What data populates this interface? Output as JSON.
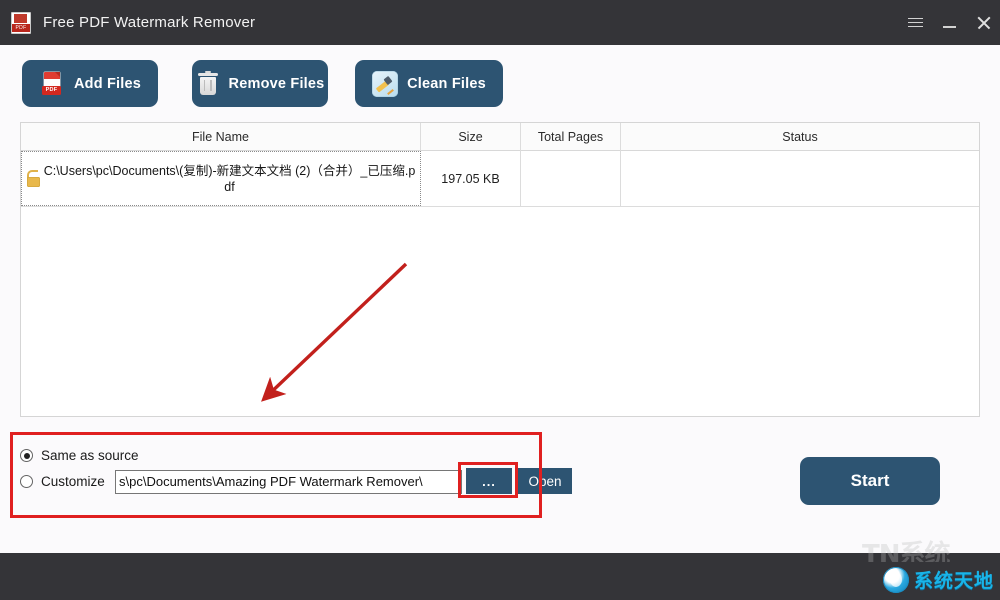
{
  "window": {
    "title": "Free PDF Watermark Remover",
    "app_icon": "pdf-document-icon",
    "controls": {
      "menu": "hamburger-menu-icon",
      "minimize": "minimize-icon",
      "close": "close-icon"
    }
  },
  "toolbar": {
    "buttons": [
      {
        "id": "add-files",
        "label": "Add Files",
        "icon": "pdf-add-icon"
      },
      {
        "id": "remove-files",
        "label": "Remove Files",
        "icon": "trash-icon"
      },
      {
        "id": "clean-files",
        "label": "Clean Files",
        "icon": "clean-brush-icon"
      }
    ],
    "button_color": "#2d5472"
  },
  "file_table": {
    "columns": [
      "File Name",
      "Size",
      "Total Pages",
      "Status"
    ],
    "rows": [
      {
        "icon": "unlocked-padlock-icon",
        "file_name": "C:\\Users\\pc\\Documents\\(复制)-新建文本文档 (2)（合并）_已压缩.pdf",
        "size": "197.05 KB",
        "total_pages": "",
        "status": ""
      }
    ]
  },
  "output_options": {
    "same_as_source": {
      "label": "Same as source",
      "selected": true
    },
    "customize": {
      "label": "Customize",
      "selected": false
    },
    "path_value": "s\\pc\\Documents\\Amazing PDF Watermark Remover\\",
    "browse_label": "...",
    "open_label": "Open"
  },
  "actions": {
    "start_label": "Start"
  },
  "watermark": {
    "faint_text": "TN系统",
    "logo_text": "系统天地",
    "logo_icon": "globe-icon",
    "logo_color": "#19b4e8"
  },
  "annotations": {
    "highlight_color": "#e02020",
    "arrow": "red-pointer-arrow"
  }
}
